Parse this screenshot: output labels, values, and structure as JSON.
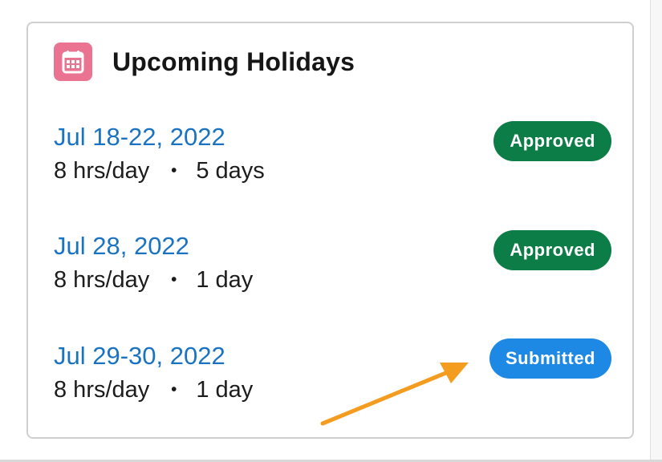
{
  "card": {
    "title": "Upcoming Holidays",
    "icon": "calendar-icon",
    "icon_color": "#ea7392"
  },
  "holidays": [
    {
      "date": "Jul 18-22, 2022",
      "hours": "8 hrs/day",
      "separator": "•",
      "duration": "5 days",
      "status": "Approved",
      "status_color": "#0c7d46"
    },
    {
      "date": "Jul 28, 2022",
      "hours": "8 hrs/day",
      "separator": "•",
      "duration": "1 day",
      "status": "Approved",
      "status_color": "#0c7d46"
    },
    {
      "date": "Jul 29-30, 2022",
      "hours": "8 hrs/day",
      "separator": "•",
      "duration": "1 day",
      "status": "Submitted",
      "status_color": "#1e88e5"
    }
  ],
  "annotation": {
    "icon": "arrow-annotation-icon",
    "color": "#f39c1f"
  }
}
